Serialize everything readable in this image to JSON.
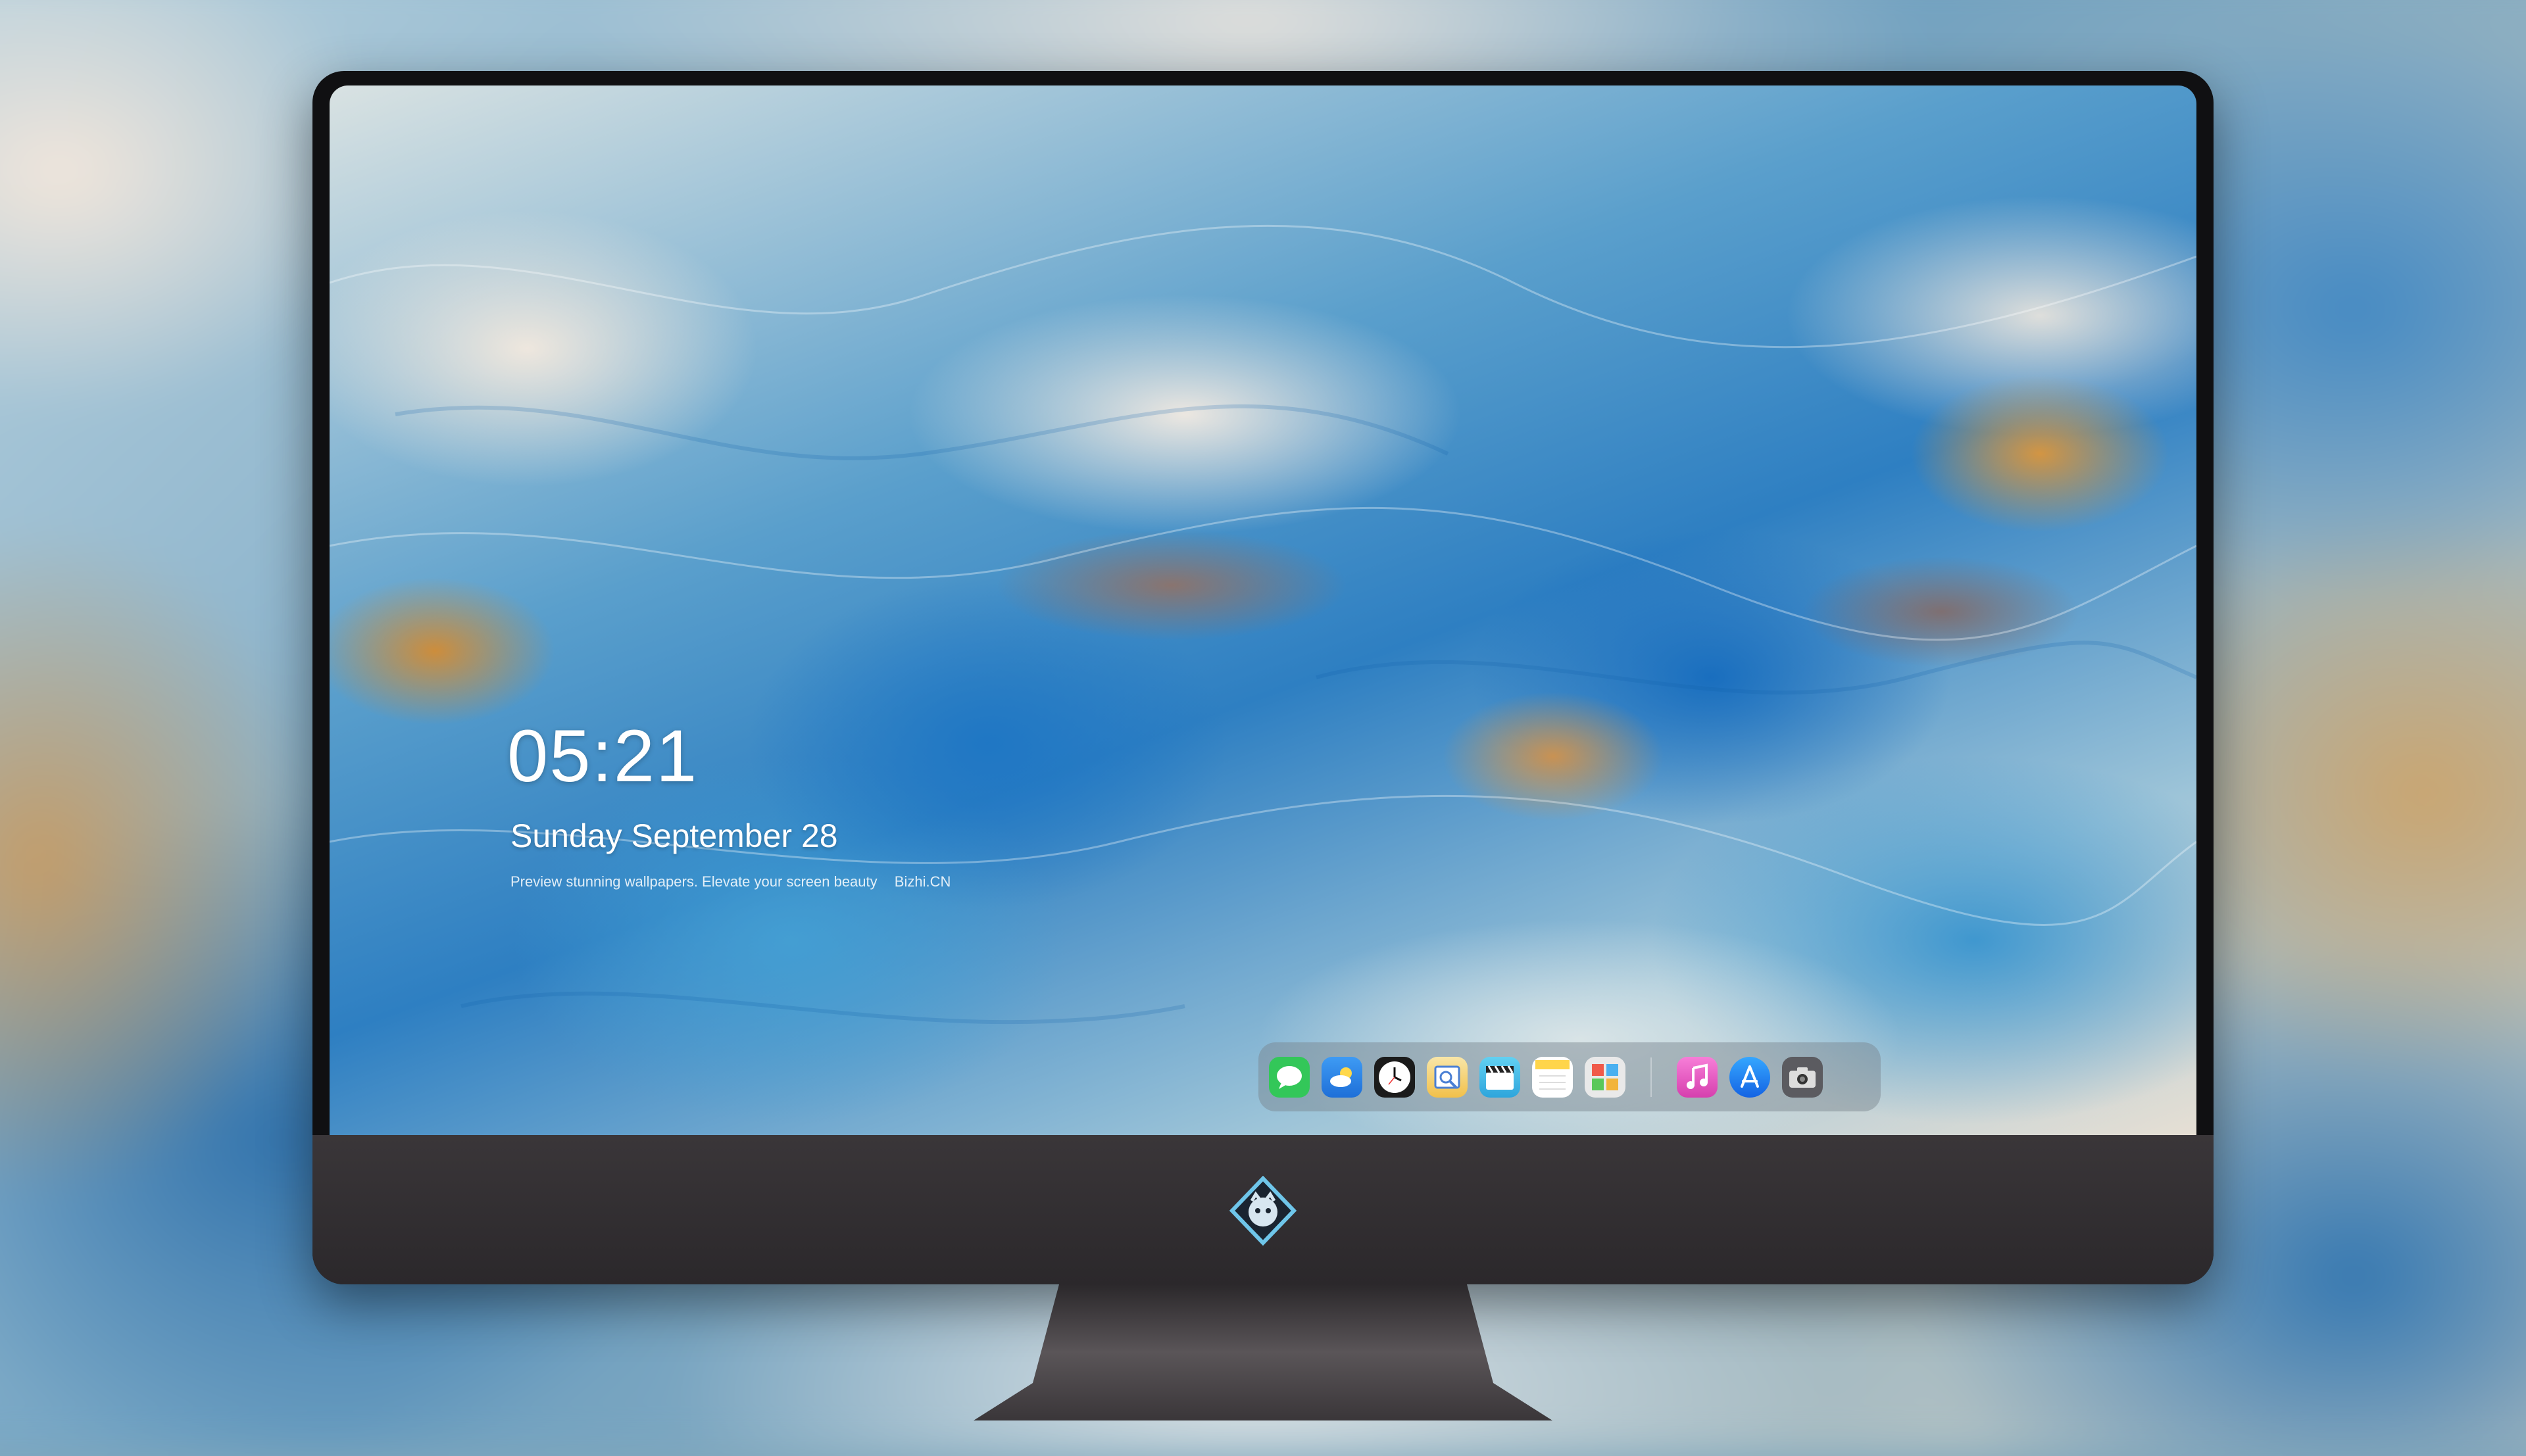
{
  "lockscreen": {
    "time": "05:21",
    "date": "Sunday September  28",
    "tagline_left": "Preview stunning wallpapers. Elevate your screen beauty",
    "tagline_right": "Bizhi.CN"
  },
  "dock": {
    "apps": [
      {
        "name": "Messages",
        "icon": "messages-icon",
        "color": "#33c759"
      },
      {
        "name": "Weather",
        "icon": "weather-icon",
        "color": "#2f8cf0"
      },
      {
        "name": "Clock",
        "icon": "clock-icon",
        "color": "#1b1b1b"
      },
      {
        "name": "Preview",
        "icon": "preview-icon",
        "color": "#f2c04a"
      },
      {
        "name": "Clips",
        "icon": "clapperboard-icon",
        "color": "#34b6e8"
      },
      {
        "name": "Notes",
        "icon": "notes-icon",
        "color": "#ffd54a"
      },
      {
        "name": "Photos",
        "icon": "photos-grid-icon",
        "color": "#e9e9e9"
      },
      {
        "name": "Music",
        "icon": "music-note-icon",
        "color": "#f04fbe"
      },
      {
        "name": "App Store",
        "icon": "app-store-icon",
        "color": "#1d8cf7"
      },
      {
        "name": "Camera",
        "icon": "camera-icon",
        "color": "#5b5b60"
      }
    ]
  },
  "colors": {
    "bezel": "#101012",
    "chin": "#333034",
    "stand": "#4a4649"
  }
}
